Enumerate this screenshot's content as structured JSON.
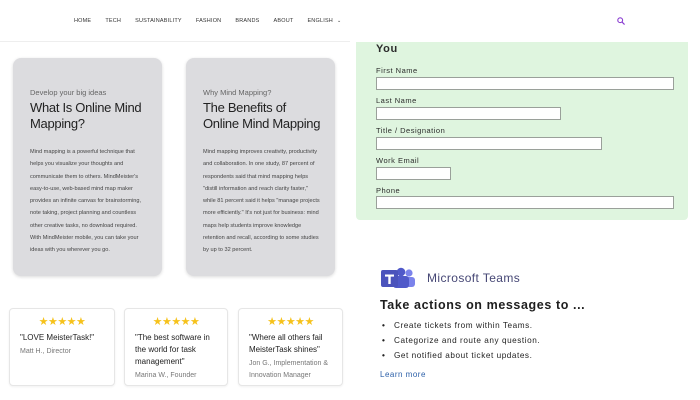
{
  "nav": {
    "items": [
      "HOME",
      "TECH",
      "SUSTAINABILITY",
      "FASHION",
      "BRANDS",
      "ABOUT",
      "ENGLISH"
    ],
    "search_icon": "search-icon",
    "accent": "#8b3fd1"
  },
  "cards": [
    {
      "eyebrow": "Develop your big ideas",
      "title": "What Is Online Mind Mapping?",
      "body": "Mind mapping is a powerful technique that helps you visualize your thoughts and communicate them to others. MindMeister's easy-to-use, web-based mind map maker provides an infinite canvas for brainstorming, note taking, project planning and countless other creative tasks, no download required. With MindMeister mobile, you can take your ideas with you wherever you go."
    },
    {
      "eyebrow": "Why Mind Mapping?",
      "title": "The Benefits of Online Mind Mapping",
      "body": "Mind mapping improves creativity, productivity and collaboration. In one study, 87 percent of respondents said that mind mapping helps \"distill information and reach clarity faster,\" while 81 percent said it helps \"manage projects more efficiently.\" It's not just for business: mind maps help students improve knowledge retention and recall, according to some studies by up to 32 percent."
    }
  ],
  "reviews": [
    {
      "stars": "★★★★★",
      "quote": "\"LOVE MeisterTask!\"",
      "who": "Matt H., Director"
    },
    {
      "stars": "★★★★★",
      "quote": "\"The best software in the world for task management\"",
      "who": "Marina W., Founder"
    },
    {
      "stars": "★★★★★",
      "quote": "\"Where all others fail MeisterTask shines\"",
      "who": "Jon G., Implementation & Innovation Manager"
    }
  ],
  "form": {
    "heading": "You",
    "fields": [
      {
        "label": "First Name",
        "value": ""
      },
      {
        "label": "Last Name",
        "value": ""
      },
      {
        "label": "Title / Designation",
        "value": ""
      },
      {
        "label": "Work Email",
        "value": ""
      },
      {
        "label": "Phone",
        "value": ""
      }
    ],
    "panel_color": "#dff5df"
  },
  "teams": {
    "brand": "Microsoft Teams",
    "headline": "Take actions on messages to ...",
    "bullets": [
      "Create tickets from within Teams.",
      "Categorize and route any question.",
      "Get notified about ticket updates."
    ],
    "learn_more": "Learn more",
    "brand_color": "#464775",
    "link_color": "#2b5fa8"
  }
}
